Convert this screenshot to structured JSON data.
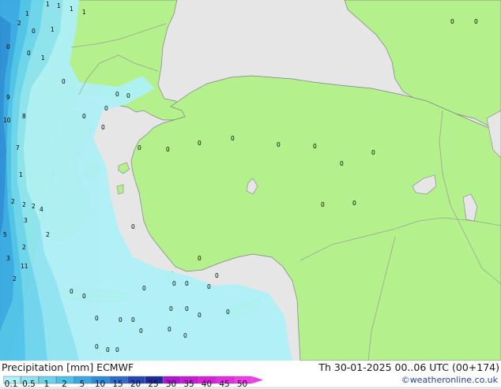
{
  "title": "Precipitation [mm]  ECMWF",
  "valid_time": "Th 30-01-2025 00..06 UTC (00+174)",
  "credit": "©weatheronline.co.uk",
  "legend": {
    "ticks": [
      "0.1",
      "0.5",
      "1",
      "2",
      "5",
      "10",
      "15",
      "20",
      "25",
      "30",
      "35",
      "40",
      "45",
      "50"
    ],
    "colors": [
      "#aef0f7",
      "#8ee4f2",
      "#6cd4ee",
      "#4dc3ec",
      "#37a9e6",
      "#2b8ddb",
      "#2a6ed0",
      "#2346b8",
      "#1b2898",
      "#b314d4",
      "#cb18d9",
      "#db1fe1",
      "#e82be6",
      "#f23ae9"
    ]
  },
  "map_colors": {
    "sea": "#e6e6e6",
    "land": "#b4f08c",
    "border": "#9aa39a",
    "coast": "#808080"
  },
  "station_values": [
    "1",
    "1",
    "1",
    "1",
    "1",
    "2",
    "0",
    "0",
    "0",
    "1",
    "0",
    "0",
    "0",
    "0",
    "0",
    "0",
    "0",
    "0",
    "0",
    "0",
    "0",
    "0",
    "0",
    "0",
    "0",
    "0",
    "0",
    "0",
    "0",
    "0",
    "2",
    "2",
    "2",
    "3",
    "3",
    "4",
    "5",
    "7",
    "8",
    "9",
    "10",
    "11",
    "2",
    "2",
    "2",
    "1",
    "1",
    "0",
    "0",
    "0",
    "0",
    "0",
    "0",
    "0",
    "0",
    "0",
    "0",
    "0",
    "0",
    "0",
    "0",
    "0",
    "0",
    "0",
    "0",
    "0",
    "0"
  ]
}
